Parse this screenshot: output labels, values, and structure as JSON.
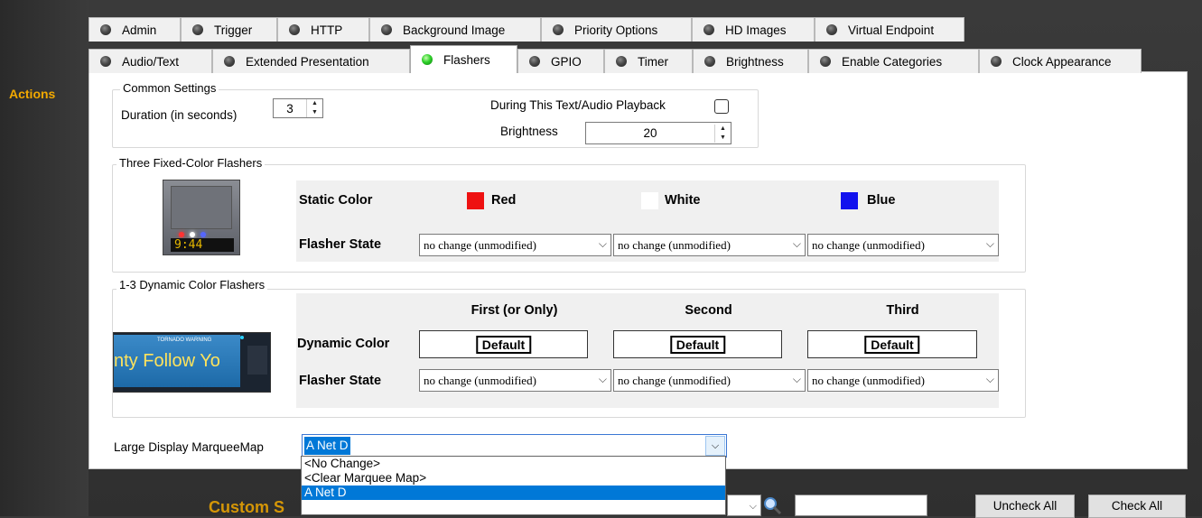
{
  "sidebar": {
    "actions_label": "Actions"
  },
  "tabs_row1": [
    {
      "label": "Admin",
      "active": false
    },
    {
      "label": "Trigger",
      "active": false
    },
    {
      "label": "HTTP",
      "active": false
    },
    {
      "label": "Background Image",
      "active": false
    },
    {
      "label": "Priority Options",
      "active": false
    },
    {
      "label": "HD Images",
      "active": false
    },
    {
      "label": "Virtual Endpoint",
      "active": false
    }
  ],
  "tabs_row2": [
    {
      "label": "Audio/Text",
      "active": false
    },
    {
      "label": "Extended Presentation",
      "active": false
    },
    {
      "label": "Flashers",
      "active": true
    },
    {
      "label": "GPIO",
      "active": false
    },
    {
      "label": "Timer",
      "active": false
    },
    {
      "label": "Brightness",
      "active": false
    },
    {
      "label": "Enable Categories",
      "active": false
    },
    {
      "label": "Clock Appearance",
      "active": false
    }
  ],
  "common": {
    "title": "Common Settings",
    "duration_label": "Duration (in seconds)",
    "duration_value": "3",
    "playback_label": "During This Text/Audio Playback",
    "playback_checked": false,
    "brightness_label": "Brightness",
    "brightness_value": "20"
  },
  "fixed": {
    "title": "Three Fixed-Color Flashers",
    "device_clock": "9:44",
    "static_color_label": "Static Color",
    "flasher_state_label": "Flasher State",
    "colors": [
      {
        "name": "Red",
        "swatch": "#ee1111"
      },
      {
        "name": "White",
        "swatch": "#ffffff"
      },
      {
        "name": "Blue",
        "swatch": "#1111ee"
      }
    ],
    "states": [
      "no change (unmodified)",
      "no change (unmodified)",
      "no change (unmodified)"
    ]
  },
  "dynamic": {
    "title": "1-3 Dynamic Color Flashers",
    "device_headline": "TORNADO WARNING",
    "device_scroll": "nty Follow Yo",
    "columns": [
      "First (or Only)",
      "Second",
      "Third"
    ],
    "dynamic_color_label": "Dynamic Color",
    "flasher_state_label": "Flasher State",
    "defaults": [
      "Default",
      "Default",
      "Default"
    ],
    "states": [
      "no change (unmodified)",
      "no change (unmodified)",
      "no change (unmodified)"
    ]
  },
  "marquee": {
    "label": "Large Display MarqueeMap",
    "selected": "A Net D",
    "options": [
      "<No Change>",
      "<Clear Marquee Map>",
      "A Net D"
    ],
    "highlighted_index": 2
  },
  "bottom": {
    "custom_partial": "Custom S",
    "uncheck_all": "Uncheck All",
    "check_all": "Check All",
    "accent": "#f2a900"
  }
}
